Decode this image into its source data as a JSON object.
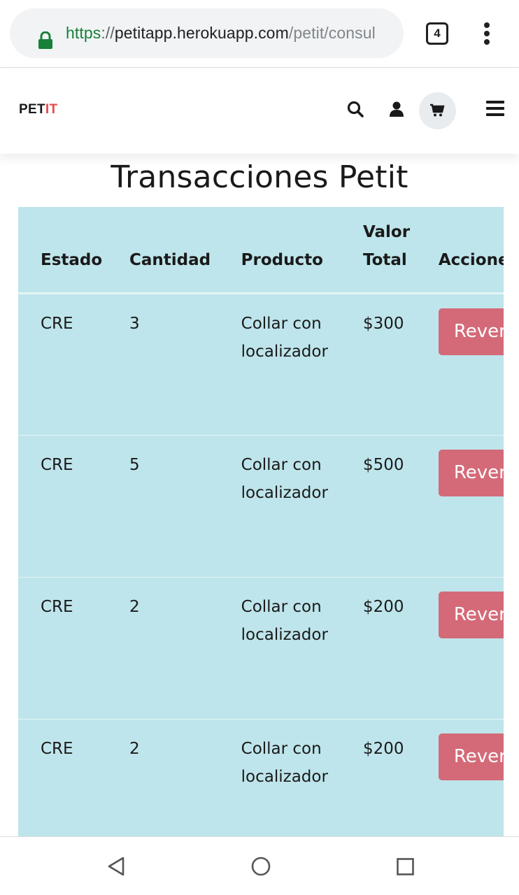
{
  "browser": {
    "url_scheme": "https",
    "url_sep": "://",
    "url_host": "petitapp.herokuapp.com",
    "url_path": "/petit/consul",
    "tab_count": "4",
    "scheme_color": "#188038"
  },
  "header": {
    "logo_main": "PET",
    "logo_accent": "IT",
    "accent_color": "#e5474b",
    "icons": [
      "search-icon",
      "user-icon",
      "cart-icon",
      "menu-icon"
    ]
  },
  "page": {
    "title": "Transacciones Petit"
  },
  "table": {
    "headers": {
      "estado": "Estado",
      "cantidad": "Cantidad",
      "producto": "Producto",
      "valor_line1": "Valor",
      "valor_line2": "Total",
      "acciones": "Acciones"
    },
    "rows": [
      {
        "estado": "CRE",
        "cantidad": "3",
        "producto": "Collar con localizador",
        "valor": "$300",
        "action": "Reversar"
      },
      {
        "estado": "CRE",
        "cantidad": "5",
        "producto": "Collar con localizador",
        "valor": "$500",
        "action": "Reversar"
      },
      {
        "estado": "CRE",
        "cantidad": "2",
        "producto": "Collar con localizador",
        "valor": "$200",
        "action": "Reversar"
      },
      {
        "estado": "CRE",
        "cantidad": "2",
        "producto": "Collar con localizador",
        "valor": "$200",
        "action": "Reversar"
      }
    ],
    "row_color": "#bee5eb",
    "button_color": "#d46a78"
  },
  "navbar": {
    "icons": [
      "back-icon",
      "home-icon",
      "recents-icon"
    ]
  }
}
